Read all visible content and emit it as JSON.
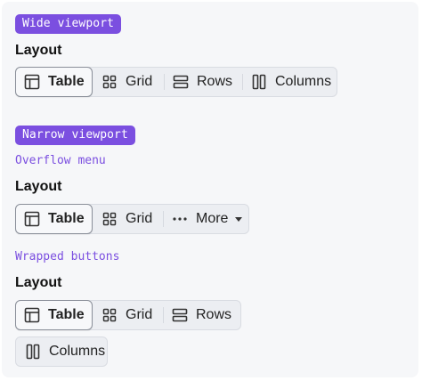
{
  "wide": {
    "badge": "Wide viewport",
    "label": "Layout",
    "buttons": {
      "table": "Table",
      "grid": "Grid",
      "rows": "Rows",
      "columns": "Columns"
    }
  },
  "narrow": {
    "badge": "Narrow viewport",
    "overflow": {
      "caption": "Overflow menu",
      "label": "Layout",
      "buttons": {
        "table": "Table",
        "grid": "Grid",
        "more": "More"
      }
    },
    "wrapped": {
      "caption": "Wrapped buttons",
      "label": "Layout",
      "buttons": {
        "table": "Table",
        "grid": "Grid",
        "rows": "Rows",
        "columns": "Columns"
      }
    }
  },
  "icons": {
    "table": "table-icon",
    "grid": "grid-icon",
    "rows": "rows-icon",
    "columns": "columns-icon",
    "more": "ellipsis-icon",
    "caret": "caret-down-icon"
  },
  "colors": {
    "accent": "#7b4fe0",
    "panel_background": "#f6f7f9",
    "group_background": "#eceef2",
    "selected_border": "#8a8f99"
  }
}
